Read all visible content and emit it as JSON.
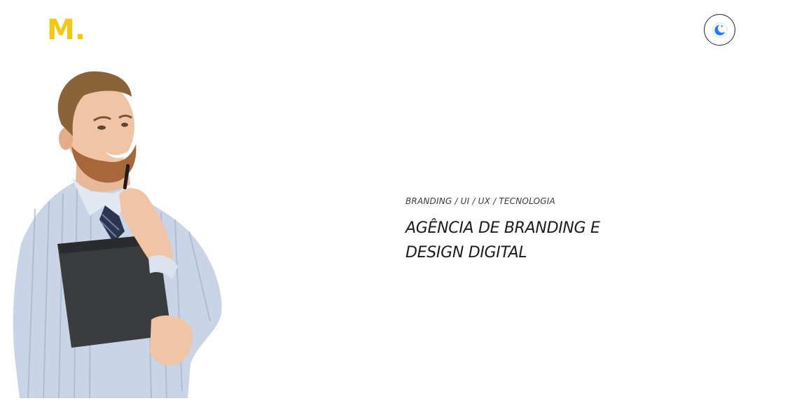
{
  "header": {
    "logo_text": "M.",
    "logo_color": "#f2c811",
    "theme_toggle_icon": "moon-icon",
    "theme_toggle_accent": "#1e7bff"
  },
  "hero": {
    "tagline": "BRANDING / UI / UX / TECNOLOGIA",
    "headline_line1": "AGÊNCIA DE BRANDING E",
    "headline_line2": "DESIGN DIGITAL",
    "image_subject": "man-holding-folder-photo"
  }
}
